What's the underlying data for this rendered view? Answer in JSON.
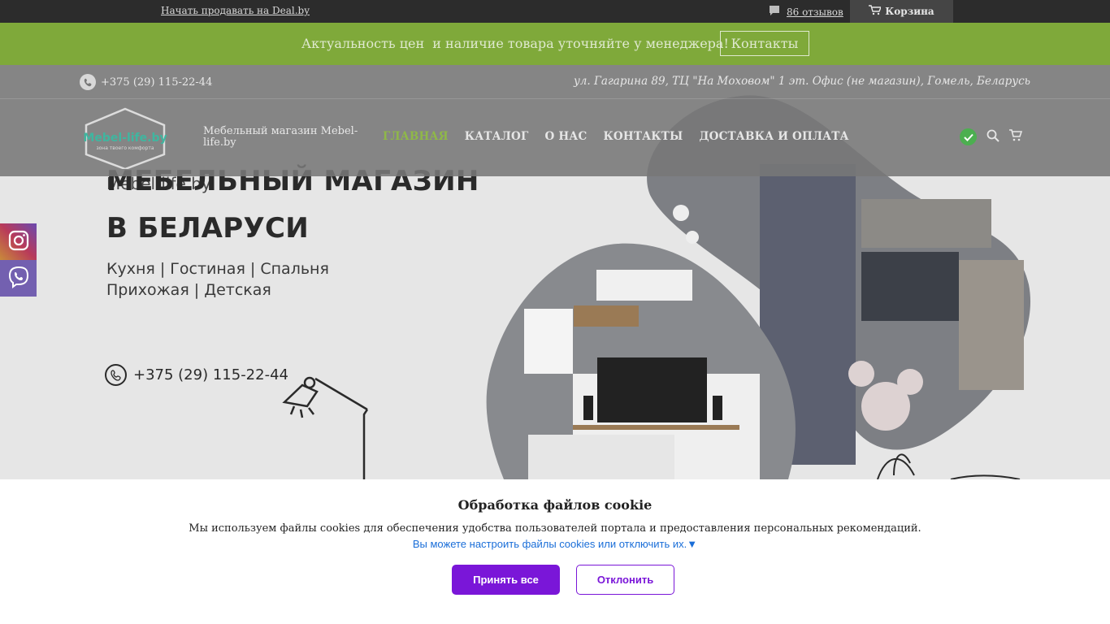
{
  "topbar": {
    "sell_link": "Начать продавать на Deal.by",
    "reviews": "86 отзывов",
    "cart": "Корзина"
  },
  "notice": {
    "text": "Актуальность цен  и наличие товара уточняйте у менеджера!",
    "button": "Контакты"
  },
  "contact": {
    "phone": "+375 (29) 115-22-44",
    "address": "ул. Гагарина 89, ТЦ \"На Моховом\" 1 эт. Офис (не магазин), Гомель, Беларусь"
  },
  "header": {
    "logo_text": "Mebel-life.by",
    "logo_slogan": "зона твоего комфорта",
    "tagline": "Мебельный магазин Mebel-life.by",
    "menu": [
      "ГЛАВНАЯ",
      "КАТАЛОГ",
      "О НАС",
      "КОНТАКТЫ",
      "ДОСТАВКА И ОПЛАТА"
    ]
  },
  "hero": {
    "brand": "Mebel-life.by",
    "title_line1": "МЕБЕЛЬНЫЙ МАГАЗИН",
    "title_line2": "В БЕЛАРУСИ",
    "cats_line1": "Кухня | Гостиная | Спальня",
    "cats_line2": "Прихожая | Детская",
    "phone": "+375 (29) 115-22-44"
  },
  "cookie": {
    "heading": "Обработка файлов cookie",
    "text": "Мы используем файлы cookies для обеспечения удобства пользователей портала и предоставления персональных рекомендаций.",
    "link": "Вы можете настроить файлы cookies или отключить их.▼",
    "accept": "Принять все",
    "reject": "Отклонить"
  },
  "colors": {
    "accent_green": "#7fa93a",
    "cookie_purple": "#7a16d8",
    "check_green": "#4caf50"
  },
  "icons": [
    "chat-icon",
    "cart-icon",
    "phone-icon",
    "check-icon",
    "search-icon",
    "instagram-icon",
    "viber-icon"
  ]
}
